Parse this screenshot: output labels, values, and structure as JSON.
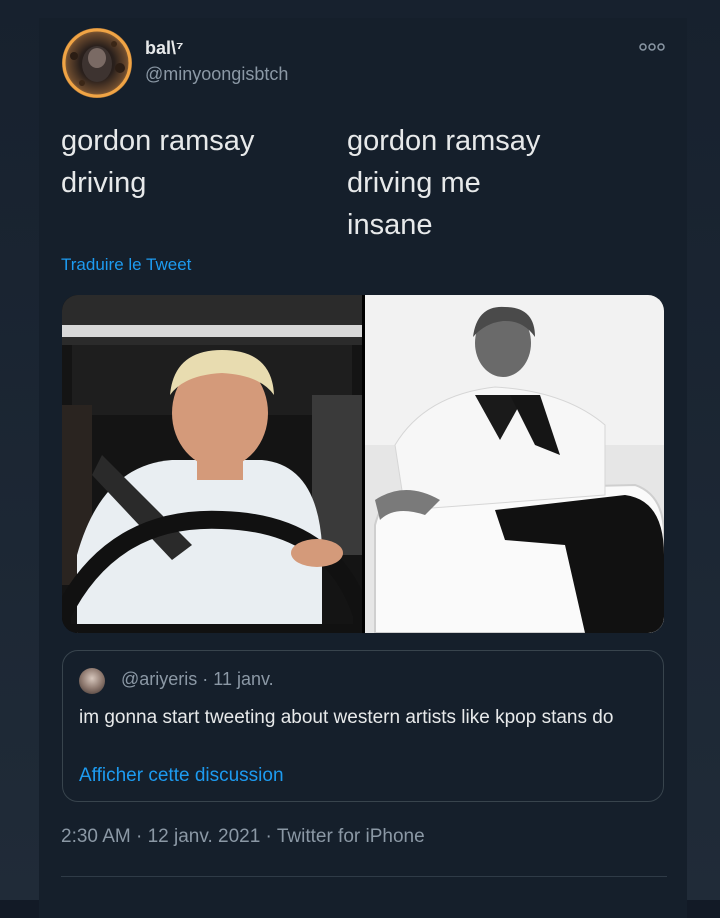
{
  "author": {
    "display_name": "bal\\⁷",
    "handle": "@minyoongisbtch"
  },
  "tweet": {
    "left_text": "gordon ramsay\ndriving",
    "right_text": "gordon ramsay\ndriving me\n insane",
    "translate_link": "Traduire le Tweet",
    "media": {
      "left_image": "Gordon Ramsay driving a car at night",
      "right_image": "Gordon Ramsay reclining on a white chair, black and white photo"
    }
  },
  "quoted_tweet": {
    "meta": "@ariyeris · 11 janv.",
    "text": "im gonna start tweeting about western artists like kpop stans do",
    "link": "Afficher cette discussion"
  },
  "footer": {
    "timestamp": "2:30 AM · 12 janv. 2021 · Twitter for iPhone"
  },
  "icons": {
    "more": "more-options-icon"
  },
  "colors": {
    "background": "#151f2b",
    "text": "#e7e9ea",
    "secondary": "#8b98a5",
    "accent": "#1d9bf0"
  }
}
